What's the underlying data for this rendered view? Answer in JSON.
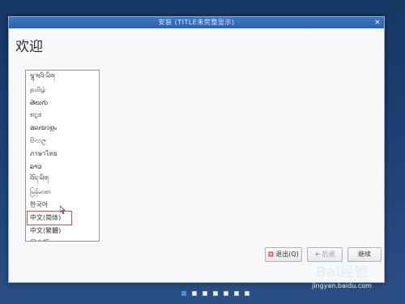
{
  "window": {
    "title": "安装 (TITLE未完整显示)",
    "close_glyph": "×"
  },
  "page": {
    "heading": "欢迎"
  },
  "languages": [
    "ལྷ་སའི་ཡིག",
    "தமிழ்",
    "తెలుగు",
    "ಕನ್ನಡ",
    "മലയാളം",
    "සිංහල",
    "ภาษาไทย",
    "ລາວ",
    "བོད་ཡིག",
    "မြန်မာစာ",
    "한국어",
    "中文(简体)",
    "中文(繁體)",
    "日本語"
  ],
  "selected_language_index": 11,
  "buttons": {
    "quit": "退出(Q)",
    "back": "后退",
    "continue": "继续"
  },
  "progress": {
    "total_steps": 7,
    "current_step": 1
  },
  "watermark": {
    "logo": "Bai经验",
    "url": "jingyan.baidu.com"
  },
  "colors": {
    "titlebar": "#2b62ae",
    "selection_outline": "#e54a4a",
    "active_dot": "#4a90d9"
  }
}
